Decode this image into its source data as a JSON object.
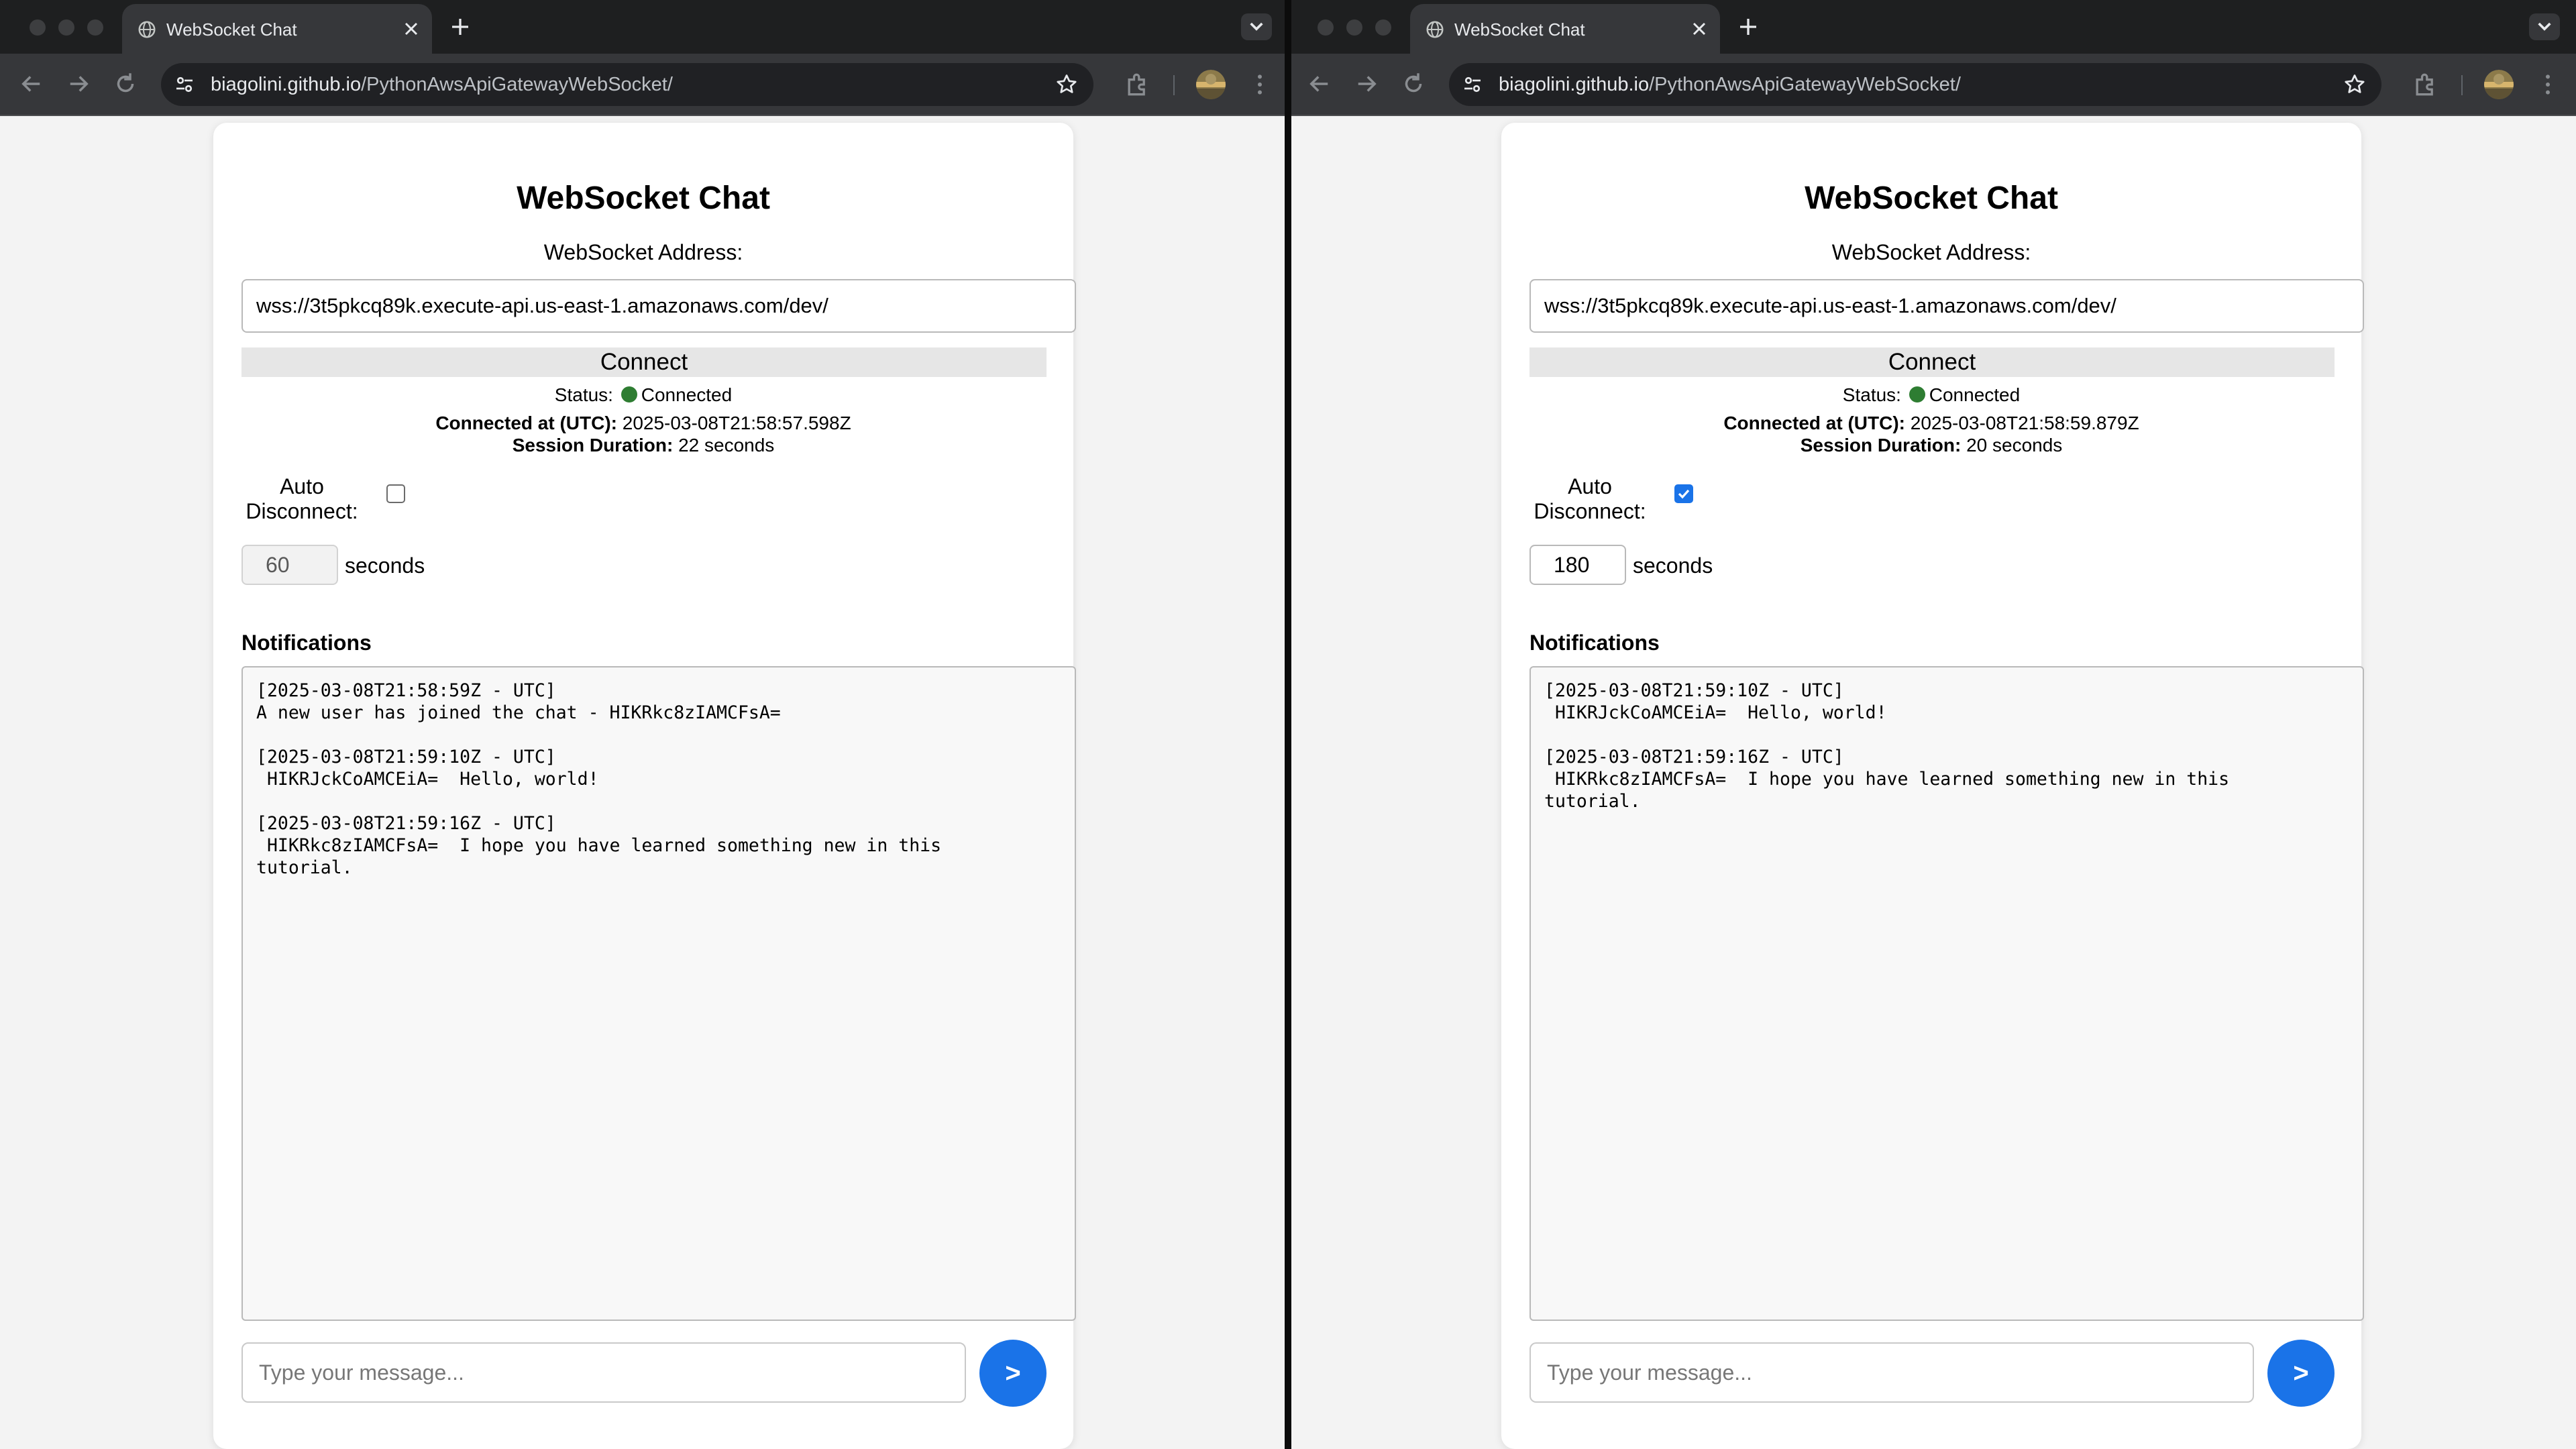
{
  "windows": [
    {
      "browser": {
        "tab_title": "WebSocket Chat",
        "url_host": "biagolini.github.io",
        "url_path": "/PythonAwsApiGatewayWebSocket/"
      },
      "app": {
        "title": "WebSocket Chat",
        "address_label": "WebSocket Address:",
        "address_value": "wss://3t5pkcq89k.execute-api.us-east-1.amazonaws.com/dev/",
        "connect_label": "Connect",
        "status_label": "Status:",
        "status_value": "Connected",
        "status_color": "#2e7d32",
        "connected_at_label": "Connected at (UTC):",
        "connected_at_value": "2025-03-08T21:58:57.598Z",
        "duration_label": "Session Duration:",
        "duration_value": "22 seconds",
        "auto_label": "Auto Disconnect:",
        "auto_checked": false,
        "seconds_value": "60",
        "seconds_label": "seconds",
        "notifications_label": "Notifications",
        "notifications": [
          "[2025-03-08T21:58:59Z - UTC]\nA new user has joined the chat - HIKRkc8zIAMCFsA=",
          "[2025-03-08T21:59:10Z - UTC]\n HIKRJckCoAMCEiA=  Hello, world!",
          "[2025-03-08T21:59:16Z - UTC]\n HIKRkc8zIAMCFsA=  I hope you have learned something new in this\ntutorial."
        ],
        "message_placeholder": "Type your message...",
        "send_label": ">"
      }
    },
    {
      "browser": {
        "tab_title": "WebSocket Chat",
        "url_host": "biagolini.github.io",
        "url_path": "/PythonAwsApiGatewayWebSocket/"
      },
      "app": {
        "title": "WebSocket Chat",
        "address_label": "WebSocket Address:",
        "address_value": "wss://3t5pkcq89k.execute-api.us-east-1.amazonaws.com/dev/",
        "connect_label": "Connect",
        "status_label": "Status:",
        "status_value": "Connected",
        "status_color": "#2e7d32",
        "connected_at_label": "Connected at (UTC):",
        "connected_at_value": "2025-03-08T21:58:59.879Z",
        "duration_label": "Session Duration:",
        "duration_value": "20 seconds",
        "auto_label": "Auto Disconnect:",
        "auto_checked": true,
        "seconds_value": "180",
        "seconds_label": "seconds",
        "notifications_label": "Notifications",
        "notifications": [
          "[2025-03-08T21:59:10Z - UTC]\n HIKRJckCoAMCEiA=  Hello, world!",
          "[2025-03-08T21:59:16Z - UTC]\n HIKRkc8zIAMCFsA=  I hope you have learned something new in this\ntutorial."
        ],
        "message_placeholder": "Type your message...",
        "send_label": ">"
      }
    }
  ]
}
